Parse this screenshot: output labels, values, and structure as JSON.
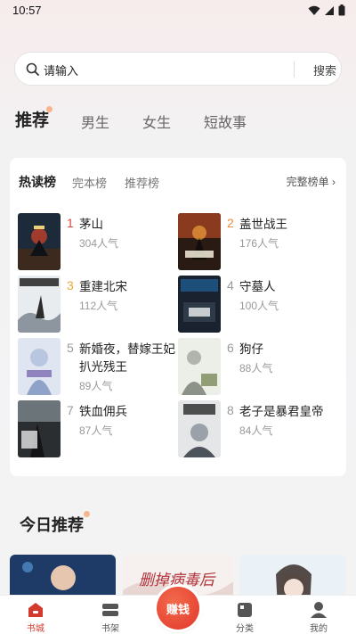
{
  "status_bar": {
    "time": "10:57"
  },
  "search": {
    "placeholder": "请输入",
    "button_label": "搜索"
  },
  "channel_tabs": [
    {
      "label": "推荐",
      "active": true
    },
    {
      "label": "男生",
      "active": false
    },
    {
      "label": "女生",
      "active": false
    },
    {
      "label": "短故事",
      "active": false
    }
  ],
  "rank_card": {
    "tabs": [
      {
        "label": "热读榜",
        "active": true
      },
      {
        "label": "完本榜",
        "active": false
      },
      {
        "label": "推荐榜",
        "active": false
      }
    ],
    "full_list_label": "完整榜单 ›",
    "books": [
      {
        "rank": "1",
        "title": "茅山",
        "popularity": "304人气"
      },
      {
        "rank": "2",
        "title": "盖世战王",
        "popularity": "176人气"
      },
      {
        "rank": "3",
        "title": "重建北宋",
        "popularity": "112人气"
      },
      {
        "rank": "4",
        "title": "守墓人",
        "popularity": "100人气"
      },
      {
        "rank": "5",
        "title": "新婚夜，替嫁王妃扒光残王",
        "popularity": "89人气"
      },
      {
        "rank": "6",
        "title": "狗仔",
        "popularity": "88人气"
      },
      {
        "rank": "7",
        "title": "铁血佣兵",
        "popularity": "87人气"
      },
      {
        "rank": "8",
        "title": "老子是暴君皇帝",
        "popularity": "84人气"
      }
    ],
    "rank_colors": {
      "first": "#e0463a",
      "second": "#f08a3c",
      "third": "#e8a93a",
      "other": "#999999"
    }
  },
  "today": {
    "title": "今日推荐",
    "promo_text": "删掉病毒后"
  },
  "bottom_nav": {
    "items": [
      {
        "label": "书城",
        "icon": "home-icon",
        "active": true
      },
      {
        "label": "书架",
        "icon": "bookshelf-icon",
        "active": false
      },
      {
        "label": "分类",
        "icon": "category-icon",
        "active": false
      },
      {
        "label": "我的",
        "icon": "profile-icon",
        "active": false
      }
    ],
    "earn_label": "赚钱"
  },
  "colors": {
    "accent": "#d23a2e",
    "earn_button": "#e6412f"
  }
}
